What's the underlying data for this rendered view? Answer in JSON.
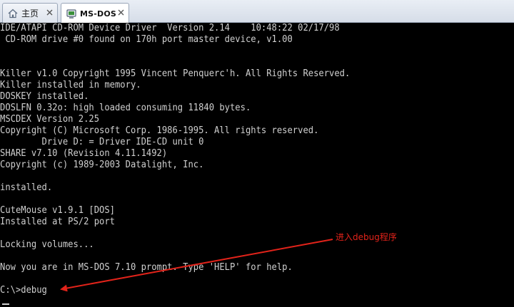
{
  "tabs": [
    {
      "label": "主页",
      "icon": "home-icon",
      "active": false
    },
    {
      "label": "MS-DOS",
      "icon": "vm-icon",
      "active": true
    }
  ],
  "console": {
    "lines": [
      "IDE/ATAPI CD-ROM Device Driver  Version 2.14    10:48:22 02/17/98",
      " CD-ROM drive #0 found on 170h port master device, v1.00",
      "",
      "",
      "Killer v1.0 Copyright 1995 Vincent Penquerc'h. All Rights Reserved.",
      "Killer installed in memory.",
      "DOSKEY installed.",
      "DOSLFN 0.32o: high loaded consuming 11840 bytes.",
      "MSCDEX Version 2.25",
      "Copyright (C) Microsoft Corp. 1986-1995. All rights reserved.",
      "        Drive D: = Driver IDE-CD unit 0",
      "SHARE v7.10 (Revision 4.11.1492)",
      "Copyright (c) 1989-2003 Datalight, Inc.",
      "",
      "installed.",
      "",
      "CuteMouse v1.9.1 [DOS]",
      "Installed at PS/2 port",
      "",
      "Locking volumes...",
      "",
      "Now you are in MS-DOS 7.10 prompt. Type 'HELP' for help.",
      "",
      "C:\\>debug"
    ]
  },
  "annotation": {
    "text": "进入debug程序",
    "color": "#e2231a"
  },
  "colors": {
    "console_bg": "#000000",
    "console_fg": "#d0d0d0",
    "tabbar_bg": "#dde3ec"
  }
}
